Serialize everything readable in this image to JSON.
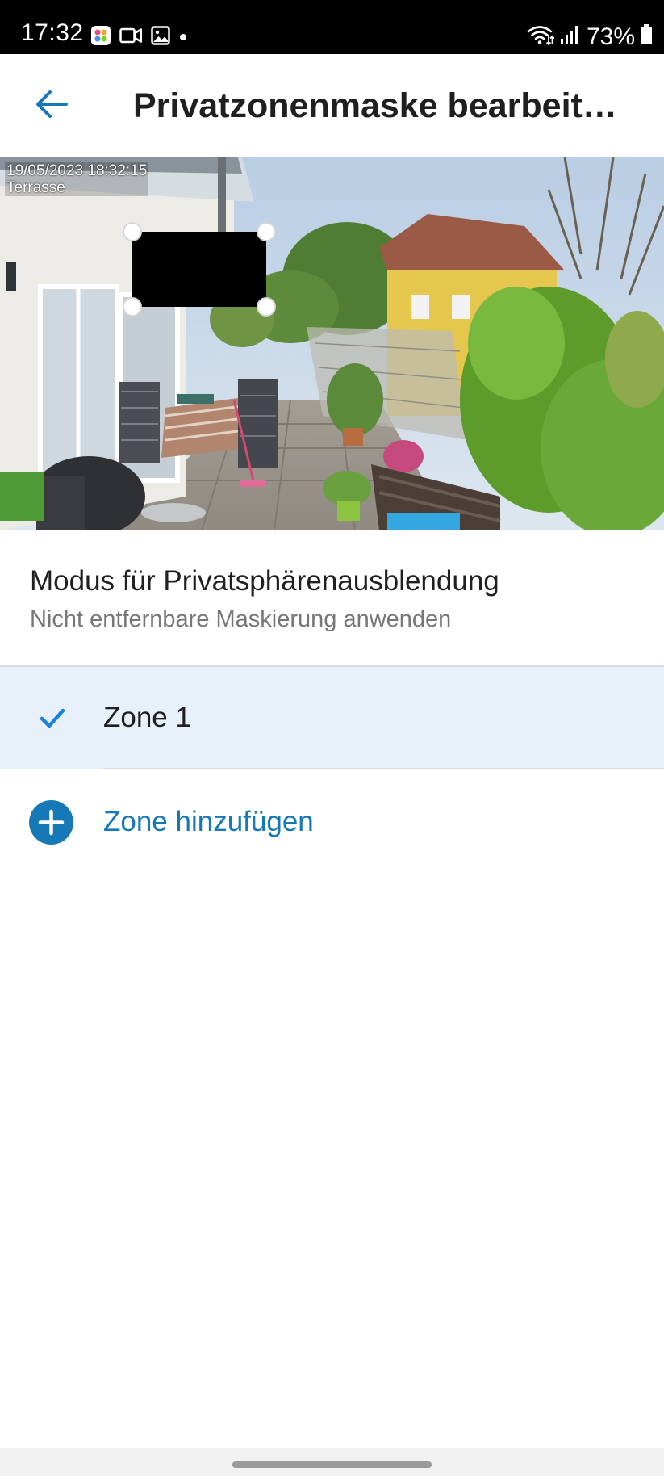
{
  "status_bar": {
    "time": "17:32",
    "battery": "73%",
    "left_icons": [
      "notification-app-icon",
      "video-icon",
      "gallery-icon",
      "dot-icon"
    ],
    "right_icons": [
      "wifi-icon",
      "signal-icon",
      "battery-icon"
    ]
  },
  "app_bar": {
    "back_icon": "arrow-left-icon",
    "title": "Privatzonenmaske bearbeit…"
  },
  "camera": {
    "timestamp": "19/05/2023 18:32:15",
    "camera_name": "Terrasse"
  },
  "privacy_mode": {
    "title": "Modus für Privatsphärenausblendung",
    "value": "Nicht entfernbare Maskierung anwenden"
  },
  "zones": [
    {
      "label": "Zone 1",
      "selected": true,
      "icon": "check-icon"
    }
  ],
  "add_zone": {
    "label": "Zone hinzufügen",
    "icon": "plus-circle-icon"
  },
  "colors": {
    "accent": "#1778b7",
    "check": "#1a84d8",
    "selected_row": "#e8f1fa",
    "divider": "#dadde1"
  }
}
